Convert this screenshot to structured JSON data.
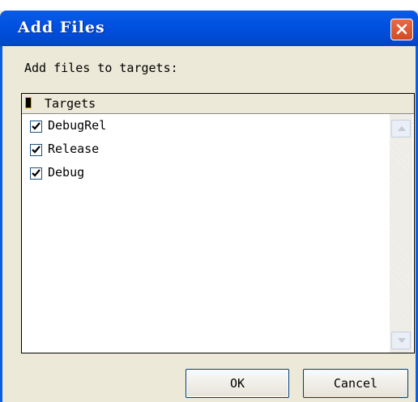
{
  "window": {
    "title": "Add Files"
  },
  "prompt": "Add files to targets:",
  "targets_list": {
    "header": "Targets",
    "items": [
      {
        "label": "DebugRel",
        "checked": true
      },
      {
        "label": "Release",
        "checked": true
      },
      {
        "label": "Debug",
        "checked": true
      }
    ]
  },
  "buttons": {
    "ok": "OK",
    "cancel": "Cancel"
  },
  "colors": {
    "titlebar": "#0050e0",
    "dialog_bg": "#ece9d8",
    "close": "#d34a24"
  }
}
